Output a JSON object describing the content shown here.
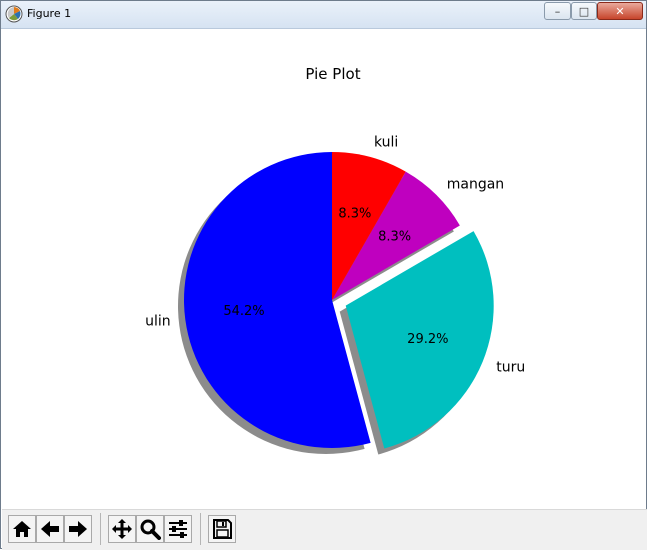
{
  "window": {
    "title": "Figure 1",
    "minimize_label": "–",
    "maximize_label": "□",
    "close_label": "✕"
  },
  "toolbar": {
    "buttons": [
      {
        "name": "home-button",
        "icon": "home-icon"
      },
      {
        "name": "back-button",
        "icon": "arrow-left-icon"
      },
      {
        "name": "forward-button",
        "icon": "arrow-right-icon"
      },
      {
        "name": "pan-button",
        "icon": "move-icon"
      },
      {
        "name": "zoom-button",
        "icon": "magnifier-icon"
      },
      {
        "name": "configure-subplots-button",
        "icon": "sliders-icon"
      },
      {
        "name": "save-button",
        "icon": "floppy-disk-icon"
      }
    ]
  },
  "chart_data": {
    "type": "pie",
    "title": "Pie Plot",
    "labels": [
      "ulin",
      "turu",
      "mangan",
      "kuli"
    ],
    "values": [
      54.2,
      29.2,
      8.3,
      8.3
    ],
    "autopct_labels": [
      "54.2%",
      "29.2%",
      "8.3%",
      "8.3%"
    ],
    "colors": [
      "#0000ff",
      "#00bfbf",
      "#bf00bf",
      "#ff0000"
    ],
    "explode": [
      0,
      0.1,
      0,
      0
    ],
    "start_angle_deg": 90,
    "counterclockwise": true,
    "shadow": true,
    "grid": false
  }
}
